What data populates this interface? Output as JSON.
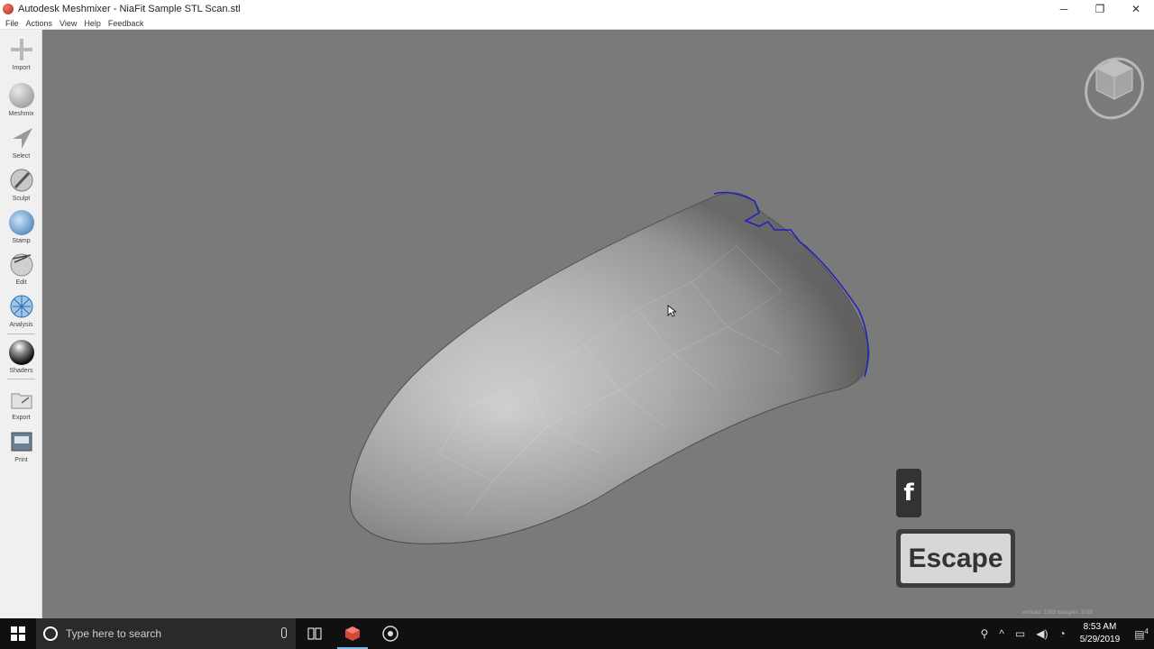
{
  "window": {
    "title": "Autodesk Meshmixer - NiaFit Sample STL Scan.stl",
    "controls": {
      "minimize": "─",
      "restore": "❐",
      "close": "✕"
    }
  },
  "menu": [
    "File",
    "Actions",
    "View",
    "Help",
    "Feedback"
  ],
  "tools": [
    {
      "label": "Import",
      "icon": "plus-icon"
    },
    {
      "label": "Meshmix",
      "icon": "meshmix-icon"
    },
    {
      "label": "Select",
      "icon": "select-arrow-icon"
    },
    {
      "label": "Sculpt",
      "icon": "sculpt-brush-icon"
    },
    {
      "label": "Stamp",
      "icon": "stamp-icon"
    },
    {
      "label": "Edit",
      "icon": "edit-icon"
    },
    {
      "label": "Analysis",
      "icon": "analysis-icon"
    },
    {
      "label": "Shaders",
      "icon": "shaders-sphere-icon"
    },
    {
      "label": "Export",
      "icon": "export-folder-icon"
    },
    {
      "label": "Print",
      "icon": "print-icon"
    }
  ],
  "viewport": {
    "mesh_stats": "vertices: 1993 triangles: 3789",
    "selection_color": "#2020c0"
  },
  "keys": {
    "f": "f",
    "escape": "Escape"
  },
  "taskbar": {
    "search_placeholder": "Type here to search",
    "time": "8:53 AM",
    "date": "5/29/2019",
    "notification_count": "4"
  },
  "colors": {
    "viewport_bg": "#7a7a7a",
    "toolbar_bg": "#f0f0f0",
    "taskbar_bg": "#101010"
  }
}
